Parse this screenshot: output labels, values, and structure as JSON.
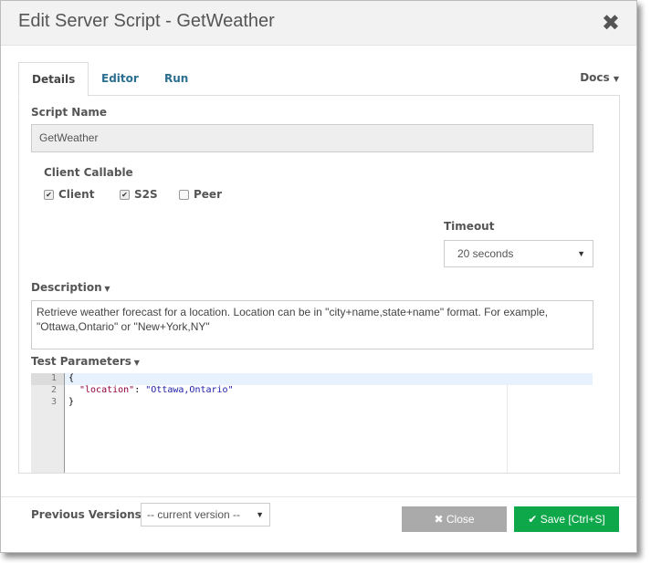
{
  "title": "Edit Server Script - GetWeather",
  "tabs": [
    "Details",
    "Editor",
    "Run"
  ],
  "docs": "Docs",
  "script_name": {
    "label": "Script Name",
    "value": "GetWeather"
  },
  "client_callable": {
    "label": "Client Callable",
    "options": [
      {
        "label": "Client",
        "checked": true
      },
      {
        "label": "S2S",
        "checked": true
      },
      {
        "label": "Peer",
        "checked": false
      }
    ]
  },
  "timeout": {
    "label": "Timeout",
    "value": "20 seconds"
  },
  "description": {
    "label": "Description",
    "value": "Retrieve weather forecast for a location. Location can be in \"city+name,state+name\" format. For example, \"Ottawa,Ontario\" or \"New+York,NY\""
  },
  "test_params": {
    "label": "Test Parameters",
    "lines": [
      "1",
      "2",
      "3"
    ],
    "code_open": "{",
    "key": "\"location\"",
    "colon": ": ",
    "val": "\"Ottawa,Ontario\"",
    "code_close": "}"
  },
  "footer": {
    "prev_label": "Previous Versions",
    "prev_value": "-- current version --",
    "close": "Close",
    "save": "Save [Ctrl+S]"
  },
  "colors": {
    "save": "#0ea84a",
    "close": "#aaaaaa"
  }
}
